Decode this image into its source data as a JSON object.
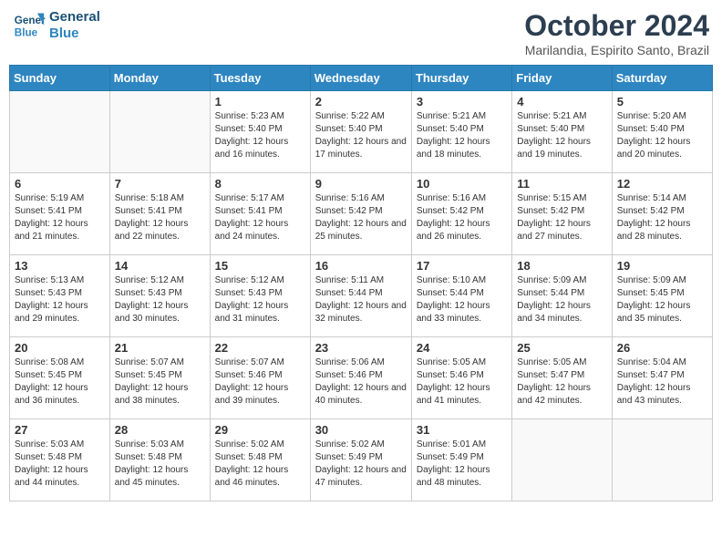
{
  "header": {
    "logo_line1": "General",
    "logo_line2": "Blue",
    "month": "October 2024",
    "location": "Marilandia, Espirito Santo, Brazil"
  },
  "weekdays": [
    "Sunday",
    "Monday",
    "Tuesday",
    "Wednesday",
    "Thursday",
    "Friday",
    "Saturday"
  ],
  "weeks": [
    [
      {
        "day": "",
        "info": ""
      },
      {
        "day": "",
        "info": ""
      },
      {
        "day": "1",
        "info": "Sunrise: 5:23 AM\nSunset: 5:40 PM\nDaylight: 12 hours and 16 minutes."
      },
      {
        "day": "2",
        "info": "Sunrise: 5:22 AM\nSunset: 5:40 PM\nDaylight: 12 hours and 17 minutes."
      },
      {
        "day": "3",
        "info": "Sunrise: 5:21 AM\nSunset: 5:40 PM\nDaylight: 12 hours and 18 minutes."
      },
      {
        "day": "4",
        "info": "Sunrise: 5:21 AM\nSunset: 5:40 PM\nDaylight: 12 hours and 19 minutes."
      },
      {
        "day": "5",
        "info": "Sunrise: 5:20 AM\nSunset: 5:40 PM\nDaylight: 12 hours and 20 minutes."
      }
    ],
    [
      {
        "day": "6",
        "info": "Sunrise: 5:19 AM\nSunset: 5:41 PM\nDaylight: 12 hours and 21 minutes."
      },
      {
        "day": "7",
        "info": "Sunrise: 5:18 AM\nSunset: 5:41 PM\nDaylight: 12 hours and 22 minutes."
      },
      {
        "day": "8",
        "info": "Sunrise: 5:17 AM\nSunset: 5:41 PM\nDaylight: 12 hours and 24 minutes."
      },
      {
        "day": "9",
        "info": "Sunrise: 5:16 AM\nSunset: 5:42 PM\nDaylight: 12 hours and 25 minutes."
      },
      {
        "day": "10",
        "info": "Sunrise: 5:16 AM\nSunset: 5:42 PM\nDaylight: 12 hours and 26 minutes."
      },
      {
        "day": "11",
        "info": "Sunrise: 5:15 AM\nSunset: 5:42 PM\nDaylight: 12 hours and 27 minutes."
      },
      {
        "day": "12",
        "info": "Sunrise: 5:14 AM\nSunset: 5:42 PM\nDaylight: 12 hours and 28 minutes."
      }
    ],
    [
      {
        "day": "13",
        "info": "Sunrise: 5:13 AM\nSunset: 5:43 PM\nDaylight: 12 hours and 29 minutes."
      },
      {
        "day": "14",
        "info": "Sunrise: 5:12 AM\nSunset: 5:43 PM\nDaylight: 12 hours and 30 minutes."
      },
      {
        "day": "15",
        "info": "Sunrise: 5:12 AM\nSunset: 5:43 PM\nDaylight: 12 hours and 31 minutes."
      },
      {
        "day": "16",
        "info": "Sunrise: 5:11 AM\nSunset: 5:44 PM\nDaylight: 12 hours and 32 minutes."
      },
      {
        "day": "17",
        "info": "Sunrise: 5:10 AM\nSunset: 5:44 PM\nDaylight: 12 hours and 33 minutes."
      },
      {
        "day": "18",
        "info": "Sunrise: 5:09 AM\nSunset: 5:44 PM\nDaylight: 12 hours and 34 minutes."
      },
      {
        "day": "19",
        "info": "Sunrise: 5:09 AM\nSunset: 5:45 PM\nDaylight: 12 hours and 35 minutes."
      }
    ],
    [
      {
        "day": "20",
        "info": "Sunrise: 5:08 AM\nSunset: 5:45 PM\nDaylight: 12 hours and 36 minutes."
      },
      {
        "day": "21",
        "info": "Sunrise: 5:07 AM\nSunset: 5:45 PM\nDaylight: 12 hours and 38 minutes."
      },
      {
        "day": "22",
        "info": "Sunrise: 5:07 AM\nSunset: 5:46 PM\nDaylight: 12 hours and 39 minutes."
      },
      {
        "day": "23",
        "info": "Sunrise: 5:06 AM\nSunset: 5:46 PM\nDaylight: 12 hours and 40 minutes."
      },
      {
        "day": "24",
        "info": "Sunrise: 5:05 AM\nSunset: 5:46 PM\nDaylight: 12 hours and 41 minutes."
      },
      {
        "day": "25",
        "info": "Sunrise: 5:05 AM\nSunset: 5:47 PM\nDaylight: 12 hours and 42 minutes."
      },
      {
        "day": "26",
        "info": "Sunrise: 5:04 AM\nSunset: 5:47 PM\nDaylight: 12 hours and 43 minutes."
      }
    ],
    [
      {
        "day": "27",
        "info": "Sunrise: 5:03 AM\nSunset: 5:48 PM\nDaylight: 12 hours and 44 minutes."
      },
      {
        "day": "28",
        "info": "Sunrise: 5:03 AM\nSunset: 5:48 PM\nDaylight: 12 hours and 45 minutes."
      },
      {
        "day": "29",
        "info": "Sunrise: 5:02 AM\nSunset: 5:48 PM\nDaylight: 12 hours and 46 minutes."
      },
      {
        "day": "30",
        "info": "Sunrise: 5:02 AM\nSunset: 5:49 PM\nDaylight: 12 hours and 47 minutes."
      },
      {
        "day": "31",
        "info": "Sunrise: 5:01 AM\nSunset: 5:49 PM\nDaylight: 12 hours and 48 minutes."
      },
      {
        "day": "",
        "info": ""
      },
      {
        "day": "",
        "info": ""
      }
    ]
  ]
}
